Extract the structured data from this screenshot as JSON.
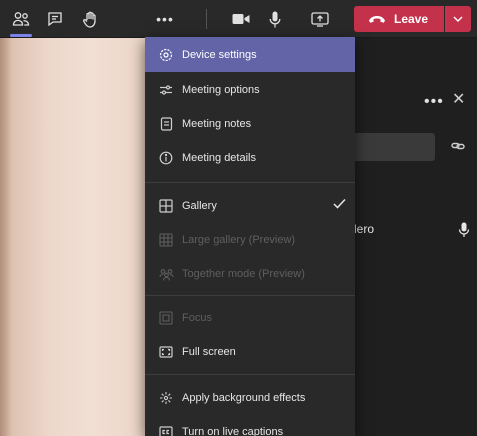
{
  "toolbar": {
    "icons": [
      "people-icon",
      "chat-icon",
      "raise-hand-icon",
      "more-options-icon",
      "camera-icon",
      "microphone-icon",
      "share-screen-icon"
    ],
    "leave_label": "Leave",
    "colors": {
      "leave": "#c4314b",
      "accent": "#7b83eb",
      "background": "#292929"
    }
  },
  "menu": {
    "items": [
      {
        "label": "Device settings",
        "icon": "gear-icon",
        "highlighted": true
      },
      {
        "label": "Meeting options",
        "icon": "sliders-icon"
      },
      {
        "label": "Meeting notes",
        "icon": "notes-icon"
      },
      {
        "label": "Meeting details",
        "icon": "info-icon"
      },
      {
        "label": "Gallery",
        "icon": "gallery-icon",
        "checked": true
      },
      {
        "label": "Large gallery (Preview)",
        "icon": "large-gallery-icon",
        "disabled": true
      },
      {
        "label": "Together mode (Preview)",
        "icon": "together-mode-icon",
        "disabled": true
      },
      {
        "label": "Focus",
        "icon": "focus-icon",
        "disabled": true
      },
      {
        "label": "Full screen",
        "icon": "fullscreen-icon"
      },
      {
        "label": "Apply background effects",
        "icon": "background-effects-icon"
      },
      {
        "label": "Turn on live captions",
        "icon": "captions-icon"
      }
    ],
    "highlight_color": "#6264a7"
  },
  "panel": {
    "participant_name_fragment": "lero"
  }
}
